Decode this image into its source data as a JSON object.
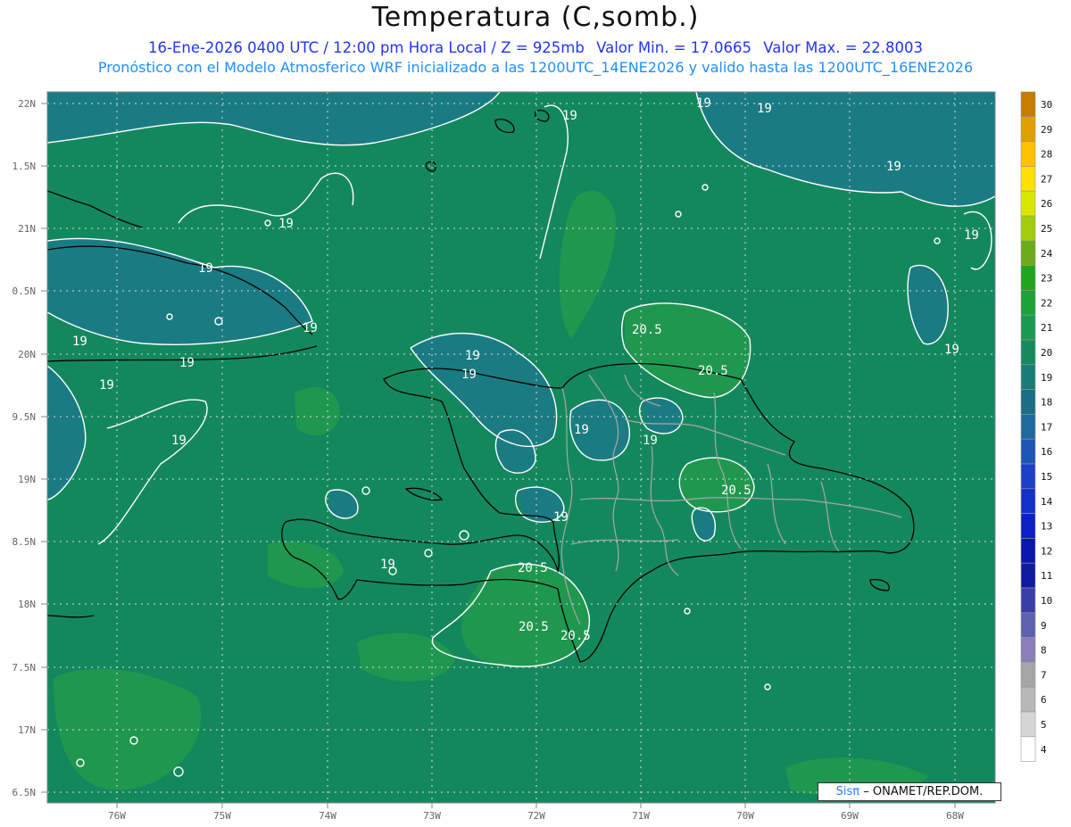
{
  "header": {
    "title": "Temperatura (C,somb.)",
    "valid_time": "16-Ene-2026 0400 UTC / 12:00 pm Hora Local / Z = 925mb",
    "min_value": "Valor Min. = 17.0665",
    "max_value": "Valor Max. = 22.8003",
    "model_info": "Pronóstico con el Modelo Atmosferico WRF inicializado a las 1200UTC_14ENE2026 y valido hasta las  1200UTC_16ENE2026"
  },
  "map": {
    "lat_labels": [
      "22N",
      "1.5N",
      "21N",
      "0.5N",
      "20N",
      "9.5N",
      "19N",
      "8.5N",
      "18N",
      "7.5N",
      "17N",
      "6.5N"
    ],
    "lon_labels": [
      "76W",
      "75W",
      "74W",
      "73W",
      "72W",
      "71W",
      "70W",
      "69W",
      "68W"
    ],
    "contour_labels": [
      "19",
      "19",
      "19",
      "19",
      "19",
      "19",
      "19",
      "19",
      "19",
      "19",
      "19",
      "19",
      "19",
      "19",
      "19",
      "19",
      "19",
      "20.5",
      "20.5",
      "20.5",
      "20.5",
      "20.5",
      "20.5"
    ],
    "colors": {
      "background_field": "#13885e",
      "cool_field": "#1a7c82",
      "warm_field": "#20974f",
      "contour": "#ffffff",
      "coastline": "#000000",
      "borders": "#a7a7a7",
      "grid": "#e0e0e0"
    }
  },
  "colorbar": {
    "labels": [
      "30",
      "29",
      "28",
      "27",
      "26",
      "25",
      "24",
      "23",
      "22",
      "21",
      "20",
      "19",
      "18",
      "17",
      "16",
      "15",
      "14",
      "13",
      "12",
      "11",
      "10",
      "9",
      "8",
      "7",
      "6",
      "5",
      "4"
    ],
    "colors": [
      "#c57c00",
      "#e0a000",
      "#ffc000",
      "#ffe000",
      "#d8e600",
      "#a3cc0a",
      "#6aab1a",
      "#20a51e",
      "#1aa33a",
      "#1b9950",
      "#168a5e",
      "#187d76",
      "#1a6e86",
      "#1d6a9e",
      "#1d55b8",
      "#1d3fc6",
      "#1530c9",
      "#0c20c4",
      "#0a16ae",
      "#101aa0",
      "#3c3ca8",
      "#6060b0",
      "#8a7fb8",
      "#a5a5a5",
      "#b8b8b8",
      "#d6d6d6",
      "#ffffff"
    ]
  },
  "credit": {
    "brand": "Sisπ",
    "text": "– ONAMET/REP.DOM."
  }
}
